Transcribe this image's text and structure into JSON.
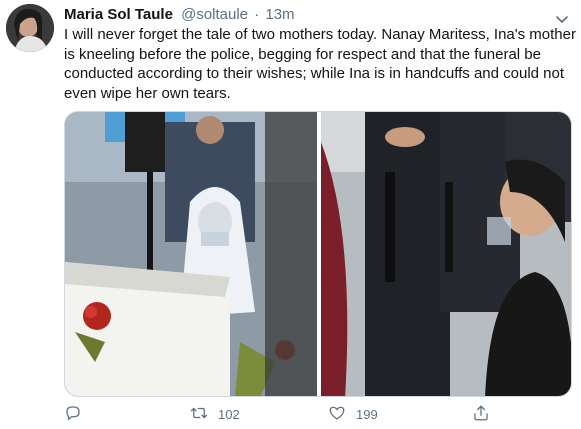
{
  "tweet": {
    "author_name": "Maria Sol Taule",
    "handle": "@soltaule",
    "separator": "·",
    "time": "13m",
    "text": "I will never forget the tale of two mothers today. Nanay Maritess, Ina's mother is kneeling before the police, begging for respect and that the funeral be conducted according to their wishes; while Ina is in handcuffs and could not even wipe her own tears."
  },
  "actions": {
    "reply_icon": "reply-icon",
    "retweet_icon": "retweet-icon",
    "retweet_count": "102",
    "like_icon": "heart-icon",
    "like_count": "199",
    "share_icon": "share-icon"
  },
  "colors": {
    "text": "#0f1419",
    "secondary": "#5b7083",
    "border": "#cfd9de"
  }
}
